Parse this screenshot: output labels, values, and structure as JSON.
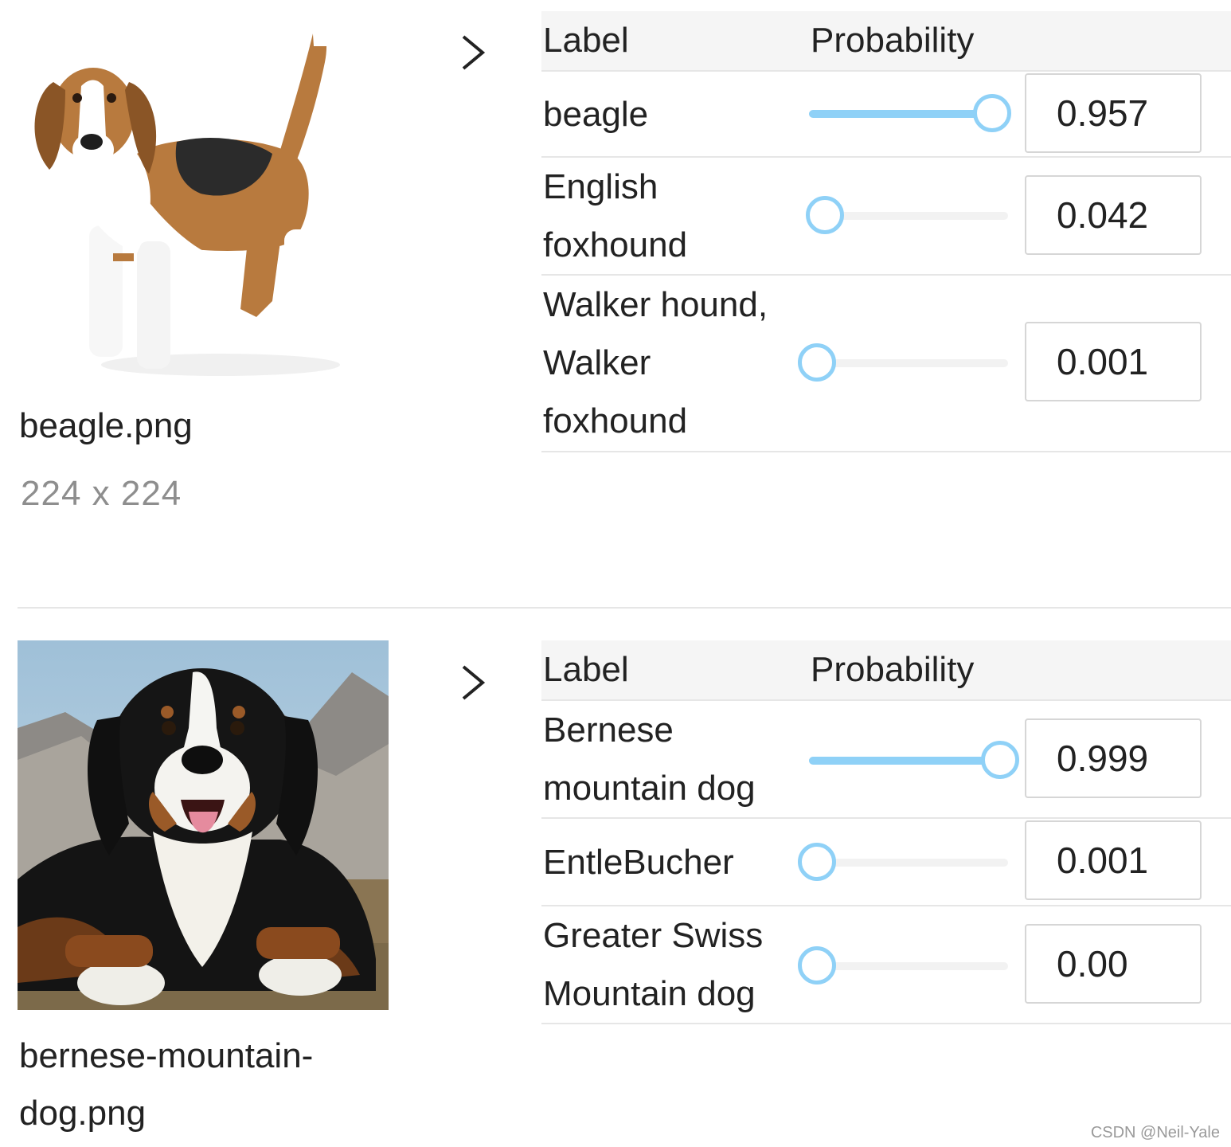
{
  "results": [
    {
      "filename": "beagle.png",
      "dimensions": "224 x 224",
      "image_subject": "beagle-dog-photo",
      "header": {
        "label": "Label",
        "probability": "Probability"
      },
      "rows": [
        {
          "label": "beagle",
          "value": "0.957",
          "level": 0.957
        },
        {
          "label": "English foxhound",
          "value": "0.042",
          "level": 0.042
        },
        {
          "label": "Walker hound, Walker foxhound",
          "value": "0.001",
          "level": 0.001
        }
      ]
    },
    {
      "filename": "bernese-mountain-dog.png",
      "image_subject": "bernese-mountain-dog-photo",
      "header": {
        "label": "Label",
        "probability": "Probability"
      },
      "rows": [
        {
          "label": "Bernese mountain dog",
          "value": "0.999",
          "level": 0.999
        },
        {
          "label": "EntleBucher",
          "value": "0.001",
          "level": 0.001
        },
        {
          "label": "Greater Swiss Mountain dog",
          "value": "0.00",
          "level": 0.0
        }
      ]
    }
  ],
  "icons": {
    "next": "chevron-right-icon"
  },
  "colors": {
    "slider_accent": "#8fd1f7",
    "slider_track": "#f2f2f2",
    "border": "#d6d6d6"
  },
  "watermark": "CSDN @Neil-Yale"
}
